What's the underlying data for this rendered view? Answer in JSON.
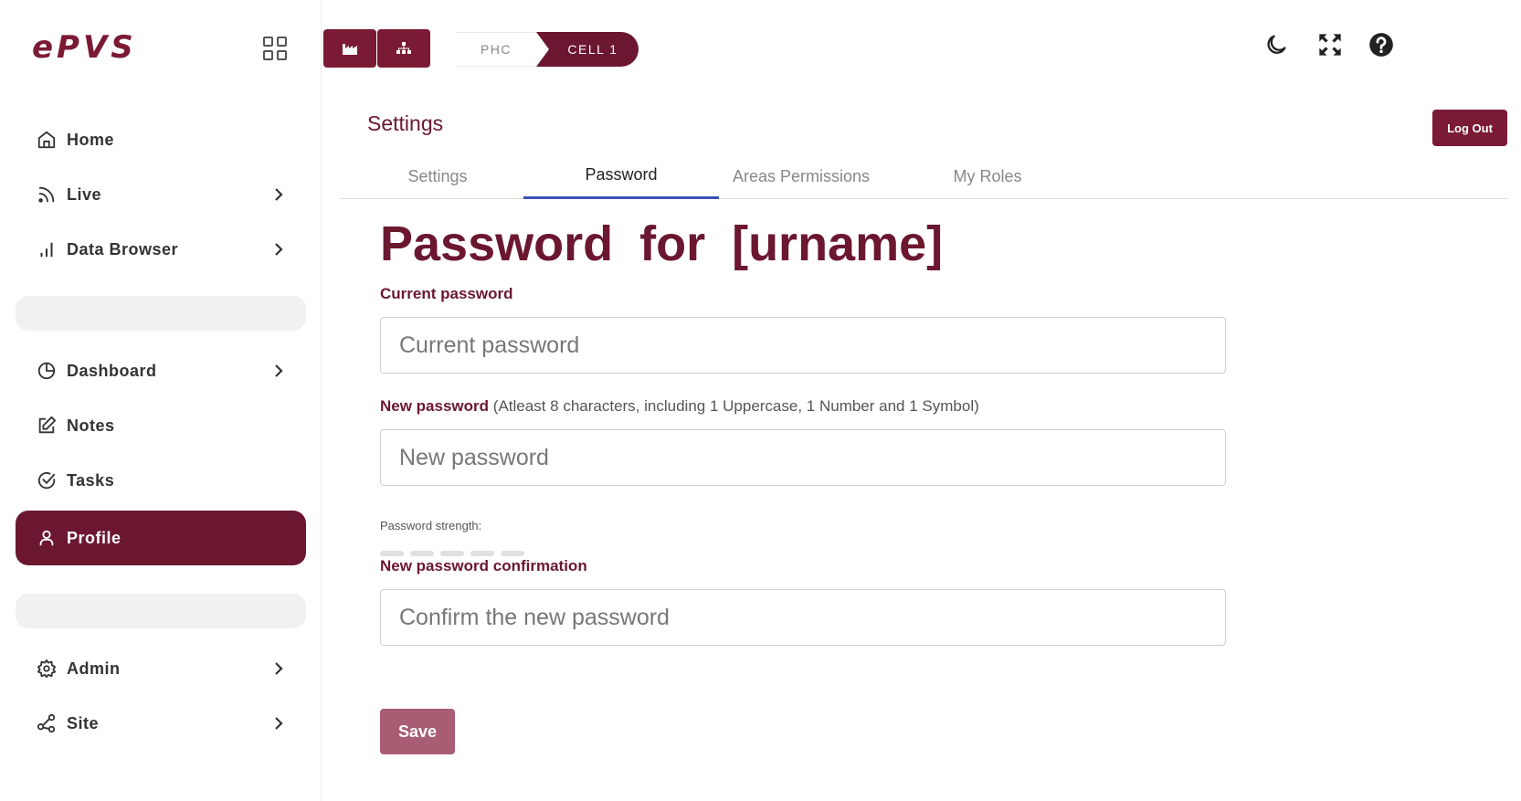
{
  "app": {
    "logo": "ePVS"
  },
  "sidebar": {
    "items": [
      {
        "label": "Home",
        "icon": "home-icon"
      },
      {
        "label": "Live",
        "icon": "rss-icon"
      },
      {
        "label": "Data Browser",
        "icon": "bar-chart-icon"
      },
      {
        "label": "Dashboard",
        "icon": "pie-chart-icon"
      },
      {
        "label": "Notes",
        "icon": "edit-icon"
      },
      {
        "label": "Tasks",
        "icon": "check-circle-icon"
      },
      {
        "label": "Profile",
        "icon": "user-icon",
        "active": true
      },
      {
        "label": "Admin",
        "icon": "gear-icon"
      },
      {
        "label": "Site",
        "icon": "share-icon"
      }
    ]
  },
  "topbar": {
    "breadcrumb": [
      "PHC",
      "CELL 1"
    ],
    "icons": [
      "factory-icon",
      "hierarchy-icon",
      "moon-icon",
      "fullscreen-icon",
      "help-icon"
    ]
  },
  "main": {
    "title": "Settings",
    "logout_label": "Log Out",
    "tabs": [
      {
        "label": "Settings"
      },
      {
        "label": "Password",
        "active": true
      },
      {
        "label": "Areas Permissions"
      },
      {
        "label": "My Roles"
      }
    ],
    "heading": "Password for [urname]",
    "current_password": {
      "label": "Current password",
      "placeholder": "Current password",
      "value": ""
    },
    "new_password": {
      "label": "New password",
      "hint": "(Atleast 8 characters, including 1 Uppercase, 1 Number and 1 Symbol)",
      "placeholder": "New password",
      "value": "",
      "strength_label": "Password strength:",
      "strength_level": 0
    },
    "confirm_password": {
      "label": "New password confirmation",
      "placeholder": "Confirm the new password",
      "value": ""
    },
    "save_label": "Save"
  },
  "colors": {
    "brand": "#6b1730",
    "brand_button": "#7a1a34",
    "save_disabled": "#a85d73",
    "tab_indicator": "#3c52b2"
  }
}
